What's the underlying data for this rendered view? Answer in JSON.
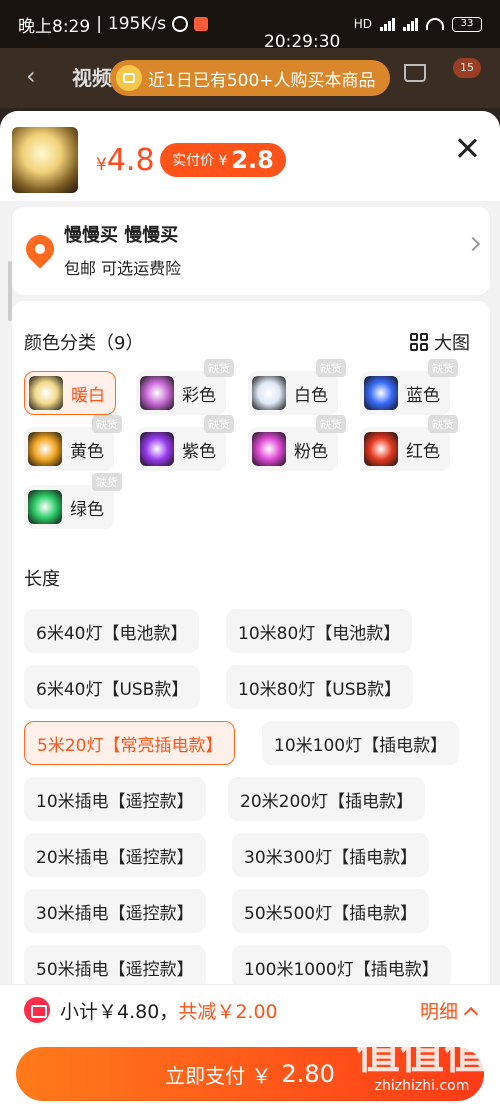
{
  "status_bar": {
    "time": "晚上8:29",
    "speed": "195K/s",
    "network": "HD",
    "battery": "33"
  },
  "overlay_time": "20:29:30",
  "background_page": {
    "title": "视频",
    "cart_count": "15"
  },
  "toast": {
    "text": "近1日已有500+人购买本商品"
  },
  "header": {
    "price_symbol": "¥",
    "price": "4.8",
    "pay_label": "实付价 ¥",
    "pay_value": "2.8"
  },
  "address": {
    "name": "慢慢买 慢慢买",
    "sub": "包邮  可选运费险"
  },
  "color_section": {
    "title": "颜色分类（9）",
    "big_image_label": "大图",
    "out_of_stock_label": "缺货",
    "options": [
      {
        "label": "暖白",
        "selected": true,
        "oos": false,
        "swatch": "#f3d98a"
      },
      {
        "label": "彩色",
        "selected": false,
        "oos": true,
        "swatch": "#c96bd8"
      },
      {
        "label": "白色",
        "selected": false,
        "oos": true,
        "swatch": "#dfe8f5"
      },
      {
        "label": "蓝色",
        "selected": false,
        "oos": true,
        "swatch": "#3a6dff"
      },
      {
        "label": "黄色",
        "selected": false,
        "oos": true,
        "swatch": "#f2a623"
      },
      {
        "label": "紫色",
        "selected": false,
        "oos": true,
        "swatch": "#9a3cf0"
      },
      {
        "label": "粉色",
        "selected": false,
        "oos": true,
        "swatch": "#e04ad6"
      },
      {
        "label": "红色",
        "selected": false,
        "oos": true,
        "swatch": "#e83a20"
      },
      {
        "label": "绿色",
        "selected": false,
        "oos": true,
        "swatch": "#2fcf6a"
      }
    ]
  },
  "length_section": {
    "title": "长度",
    "options": [
      {
        "label": "6米40灯【电池款】",
        "selected": false
      },
      {
        "label": "10米80灯【电池款】",
        "selected": false
      },
      {
        "label": "6米40灯【USB款】",
        "selected": false
      },
      {
        "label": "10米80灯【USB款】",
        "selected": false
      },
      {
        "label": "5米20灯【常亮插电款】",
        "selected": true
      },
      {
        "label": "10米100灯【插电款】",
        "selected": false
      },
      {
        "label": "10米插电【遥控款】",
        "selected": false
      },
      {
        "label": "20米200灯【插电款】",
        "selected": false
      },
      {
        "label": "20米插电【遥控款】",
        "selected": false
      },
      {
        "label": "30米300灯【插电款】",
        "selected": false
      },
      {
        "label": "30米插电【遥控款】",
        "selected": false
      },
      {
        "label": "50米500灯【插电款】",
        "selected": false
      },
      {
        "label": "50米插电【遥控款】",
        "selected": false
      },
      {
        "label": "100米1000灯【插电款】",
        "selected": false
      }
    ]
  },
  "bottom": {
    "subtotal": "小计￥4.80，",
    "reduce": "共减￥2.00",
    "detail": "明细",
    "pay_label": "立即支付 ￥",
    "pay_amount": "2.80"
  },
  "watermark": {
    "mark": "值值值",
    "site": "zhizhizhi.com"
  },
  "colors": {
    "accent": "#ff5319",
    "selected_bg": "#fff1ea"
  }
}
